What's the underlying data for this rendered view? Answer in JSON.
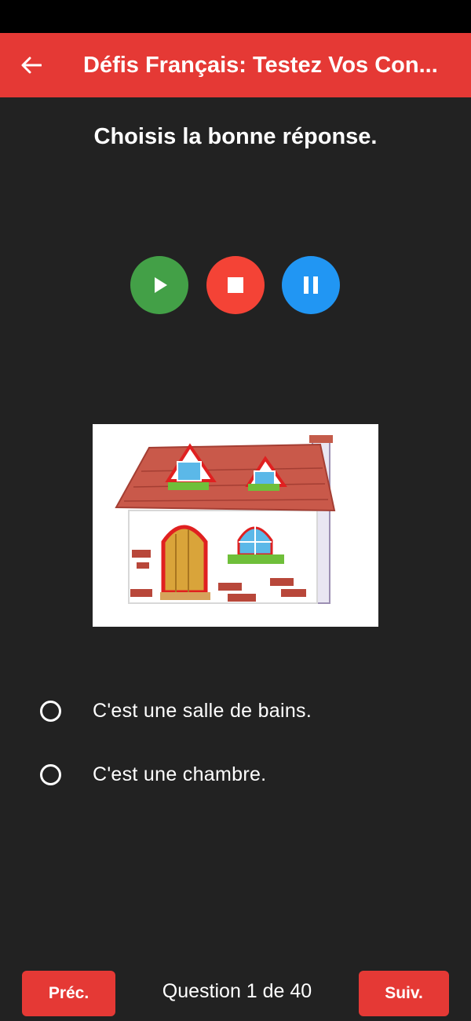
{
  "app_bar": {
    "title": "Défis Français: Testez Vos Con...",
    "back_icon": "arrow-left-icon",
    "color": "#e53935"
  },
  "question": {
    "prompt": "Choisis la bonne réponse.",
    "image": "house-illustration",
    "options": [
      {
        "label": "C'est une salle de bains.",
        "selected": false
      },
      {
        "label": "C'est une chambre.",
        "selected": false
      }
    ]
  },
  "media": {
    "play_icon": "play-icon",
    "stop_icon": "stop-icon",
    "pause_icon": "pause-icon",
    "colors": {
      "play": "#43a047",
      "stop": "#f44336",
      "pause": "#2196f3"
    }
  },
  "footer": {
    "prev_label": "Préc.",
    "next_label": "Suiv.",
    "counter": "Question 1 de 40"
  }
}
